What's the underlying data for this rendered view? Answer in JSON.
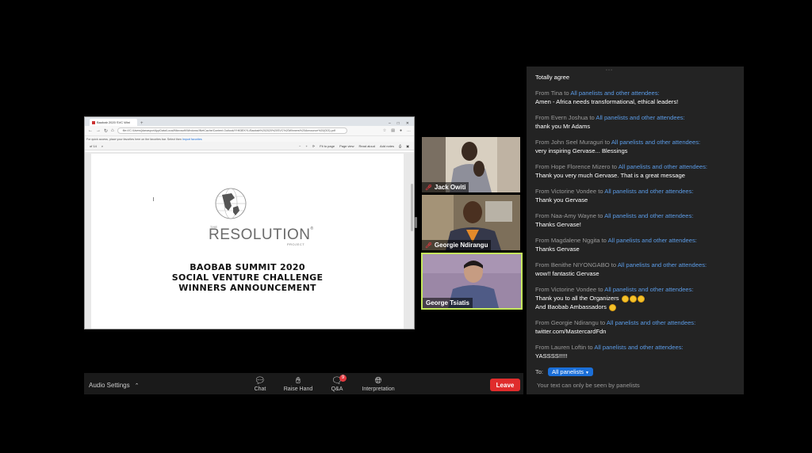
{
  "browser": {
    "tab_title": "Baobab 2020 SVC Wini",
    "url": "file:///C:/Users/jdanaspor/AppData/Local/Microsoft/Windows/INetCache/Content.Outlook/YHK5EKYL/Baobab%202020%20SVC%20Winners%20Announce%20(003).pdf",
    "favorites_text": "For quick access, place your favorites here on the favorites bar. Select",
    "favorites_tail": "then",
    "favorites_link": "Import favorites",
    "page_indicator": "of 14",
    "pdf_tools": [
      "Fit to page",
      "Page view",
      "Read aloud",
      "Add notes"
    ]
  },
  "slide": {
    "logo_the": "THE",
    "logo_name": "RESOLUTION",
    "logo_mark": "®",
    "logo_project": "PROJECT",
    "line1": "BAOBAB SUMMIT 2020",
    "line2": "SOCIAL VENTURE CHALLENGE",
    "line3": "WINNERS ANNOUNCEMENT"
  },
  "videos": [
    {
      "name": "Jack Owiti",
      "muted": true
    },
    {
      "name": "Georgie Ndirangu",
      "muted": true
    },
    {
      "name": "George Tsiatis",
      "muted": false,
      "active_speaker": true
    }
  ],
  "toolbar": {
    "audio_settings": "Audio Settings",
    "chat": "Chat",
    "raise_hand": "Raise Hand",
    "qa": "Q&A",
    "qa_badge": "9",
    "interpretation": "Interpretation",
    "leave": "Leave"
  },
  "chat": {
    "first_text": "Totally agree",
    "messages": [
      {
        "from": "From Tina to",
        "to": "All panelists and other attendees:",
        "text": "Amen - Africa needs transformational, ethical leaders!"
      },
      {
        "from": "From Evern Joshua to",
        "to": "All panelists and other attendees:",
        "text": "thank you Mr Adams"
      },
      {
        "from": "From John Seel Muraguri to",
        "to": "All panelists and other attendees:",
        "text": "very inspiring Gervase... Blessings"
      },
      {
        "from": "From Hope Florence Mizero to",
        "to": "All panelists and other attendees:",
        "text": "Thank you very much Gervase. That is a great message"
      },
      {
        "from": "From Victorine Vondee to",
        "to": "All panelists and other attendees:",
        "text": "Thank you Gervase"
      },
      {
        "from": "From Naa-Amy Wayne to",
        "to": "All panelists and other attendees:",
        "text": "Thanks Gervase!"
      },
      {
        "from": "From Magdalene Nggita to",
        "to": "All panelists and other attendees:",
        "text": "Thanks Gervase"
      },
      {
        "from": "From Benithe NIYONGABO to",
        "to": "All panelists and other attendees:",
        "text": "wow!! fantastic Gervase"
      },
      {
        "from": "From Victorine Vondee to",
        "to": "All panelists and other attendees:",
        "text": "Thank you to all the Organizers",
        "text2": "And Baobab Ambassadors"
      },
      {
        "from": "From Georgie Ndirangu to",
        "to": "All panelists and other attendees:",
        "text": "twitter.com/MastercardFdn"
      },
      {
        "from": "From Lauren Loftin to",
        "to": "All panelists and other attendees:",
        "text": "YASSSS!!!!!"
      }
    ],
    "to_label": "To:",
    "to_value": "All panelists",
    "hint": "Your text can only be seen by panelists"
  },
  "colors": {
    "leave": "#e02c2c",
    "active_speaker_border": "#c5e85d",
    "chat_recipient": "#5b9be6",
    "chat_bg": "#232323"
  }
}
